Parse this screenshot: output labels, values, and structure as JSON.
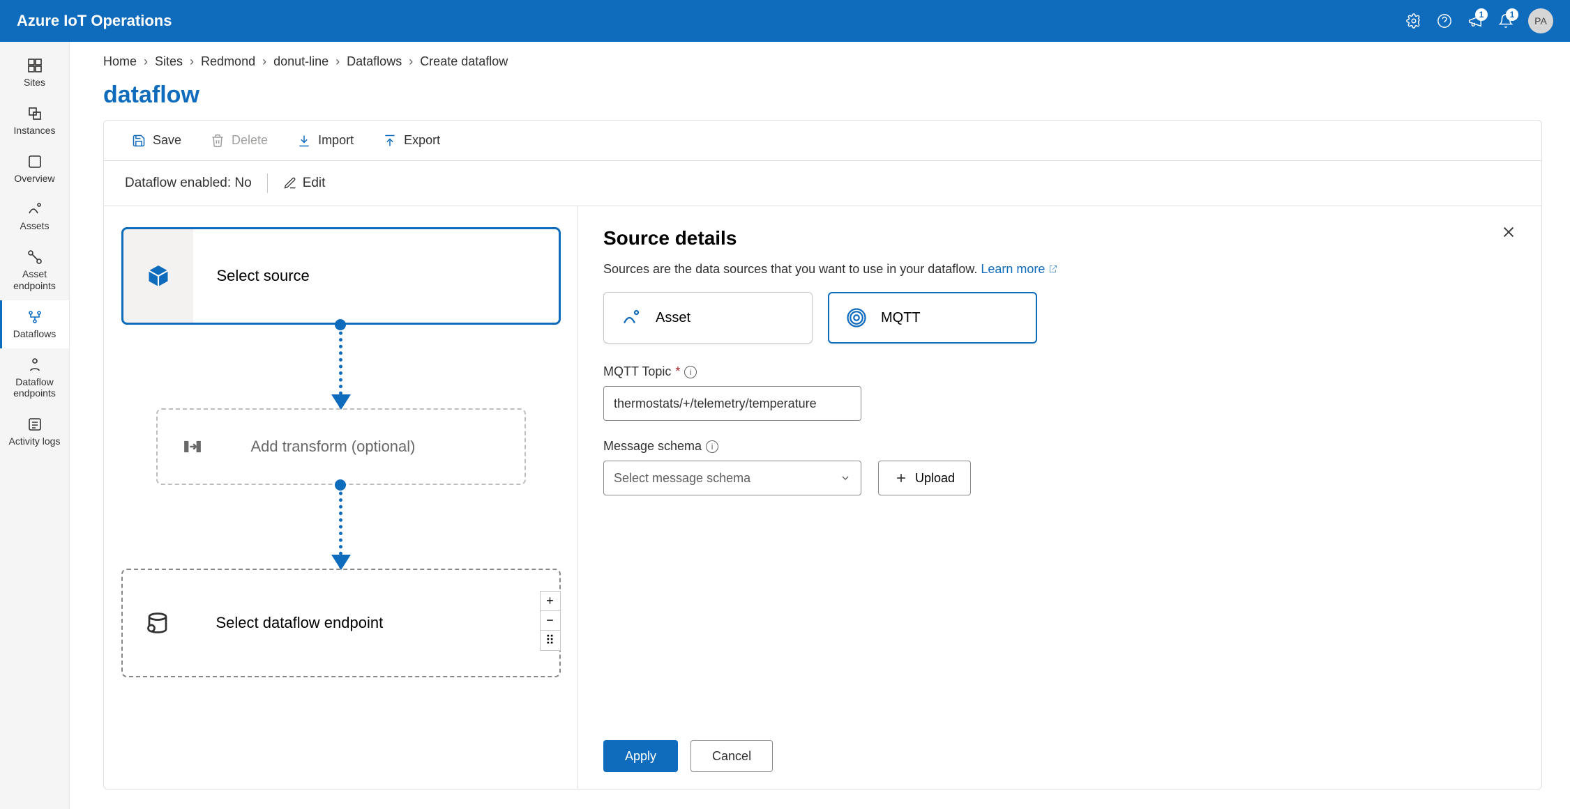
{
  "header": {
    "title": "Azure IoT Operations",
    "bell_badge": "1",
    "feedback_badge": "1",
    "avatar": "PA"
  },
  "rail": {
    "items": [
      {
        "id": "sites",
        "label": "Sites"
      },
      {
        "id": "instances",
        "label": "Instances"
      },
      {
        "id": "overview",
        "label": "Overview"
      },
      {
        "id": "assets",
        "label": "Assets"
      },
      {
        "id": "asset-endpoints",
        "label": "Asset endpoints"
      },
      {
        "id": "dataflows",
        "label": "Dataflows"
      },
      {
        "id": "dataflow-endpoints",
        "label": "Dataflow endpoints"
      },
      {
        "id": "activity-logs",
        "label": "Activity logs"
      }
    ]
  },
  "breadcrumbs": {
    "items": [
      "Home",
      "Sites",
      "Redmond",
      "donut-line",
      "Dataflows",
      "Create dataflow"
    ]
  },
  "page": {
    "title": "dataflow"
  },
  "toolbar": {
    "save": "Save",
    "delete": "Delete",
    "import": "Import",
    "export": "Export"
  },
  "status": {
    "enabled_label": "Dataflow enabled:",
    "enabled_value": "No",
    "edit": "Edit"
  },
  "canvas": {
    "source": "Select source",
    "transform": "Add transform (optional)",
    "endpoint": "Select dataflow endpoint",
    "plus": "+",
    "minus": "−",
    "grab": "⠿"
  },
  "details": {
    "title": "Source details",
    "subtitle": "Sources are the data sources that you want to use in your dataflow.",
    "learn_more": "Learn more",
    "option_asset": "Asset",
    "option_mqtt": "MQTT",
    "mqtt_topic_label": "MQTT Topic",
    "mqtt_topic_value": "thermostats/+/telemetry/temperature",
    "schema_label": "Message schema",
    "schema_placeholder": "Select message schema",
    "upload": "Upload",
    "apply": "Apply",
    "cancel": "Cancel"
  }
}
